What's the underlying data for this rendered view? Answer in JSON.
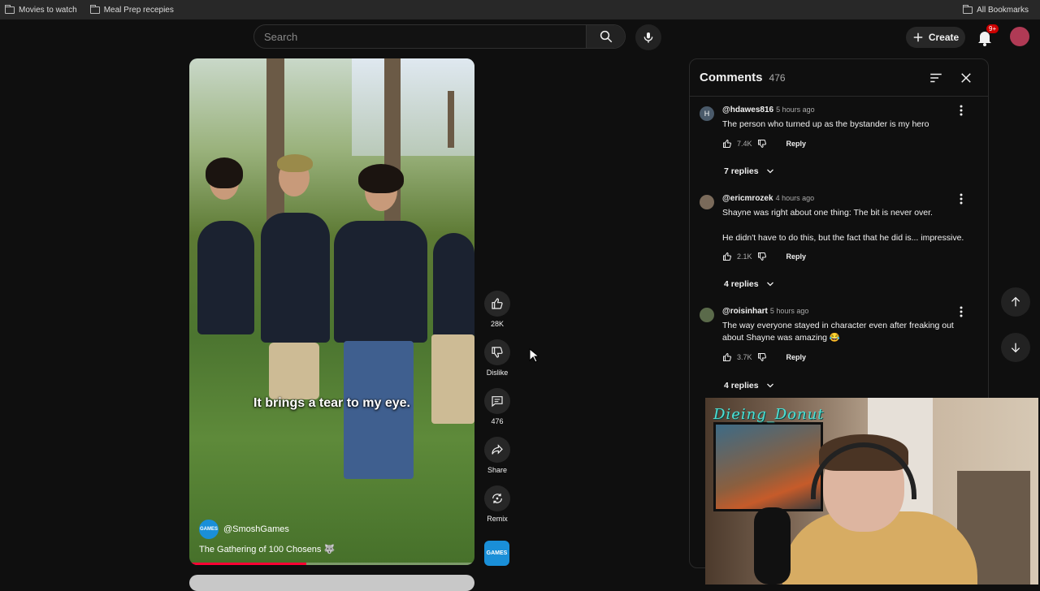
{
  "bookmarks": {
    "items": [
      {
        "label": "Movies to watch"
      },
      {
        "label": "Meal Prep recepies"
      }
    ],
    "all_label": "All Bookmarks"
  },
  "header": {
    "search_placeholder": "Search",
    "create_label": "Create",
    "notif_badge": "9+"
  },
  "video": {
    "caption": "It brings a tear to my eye.",
    "channel": "@SmoshGames",
    "channel_logo_text": "GAMES",
    "title": "The Gathering of 100 Chosens 🐺",
    "progress": 0.41
  },
  "actions": {
    "like_count": "28K",
    "dislike_label": "Dislike",
    "comments_count": "476",
    "share_label": "Share",
    "remix_label": "Remix"
  },
  "comments": {
    "title": "Comments",
    "count": "476",
    "items": [
      {
        "user": "@hdawes816",
        "time": "5 hours ago",
        "avatar_letter": "H",
        "avatar_color": "#4a5a6a",
        "text": "The person who turned up as the bystander is my hero",
        "likes": "7.4K",
        "reply_label": "Reply",
        "replies": "7 replies"
      },
      {
        "user": "@ericmrozek",
        "time": "4 hours ago",
        "avatar_letter": "",
        "avatar_color": "#7a6a5a",
        "text": "Shayne was right about one thing: The bit is never over.",
        "text2": "He didn't have to do this, but the fact that he did is... impressive.",
        "likes": "2.1K",
        "reply_label": "Reply",
        "replies": "4 replies"
      },
      {
        "user": "@roisinhart",
        "time": "5 hours ago",
        "avatar_letter": "",
        "avatar_color": "#5a6a4a",
        "text": "The way everyone stayed in character even after freaking out about Shayne was amazing 😂",
        "likes": "3.7K",
        "reply_label": "Reply",
        "replies": "4 replies"
      }
    ]
  },
  "webcam": {
    "watermark": "Dieing_Donut"
  },
  "colors": {
    "accent_red": "#ff0033",
    "channel_blue": "#1a8fd8"
  }
}
